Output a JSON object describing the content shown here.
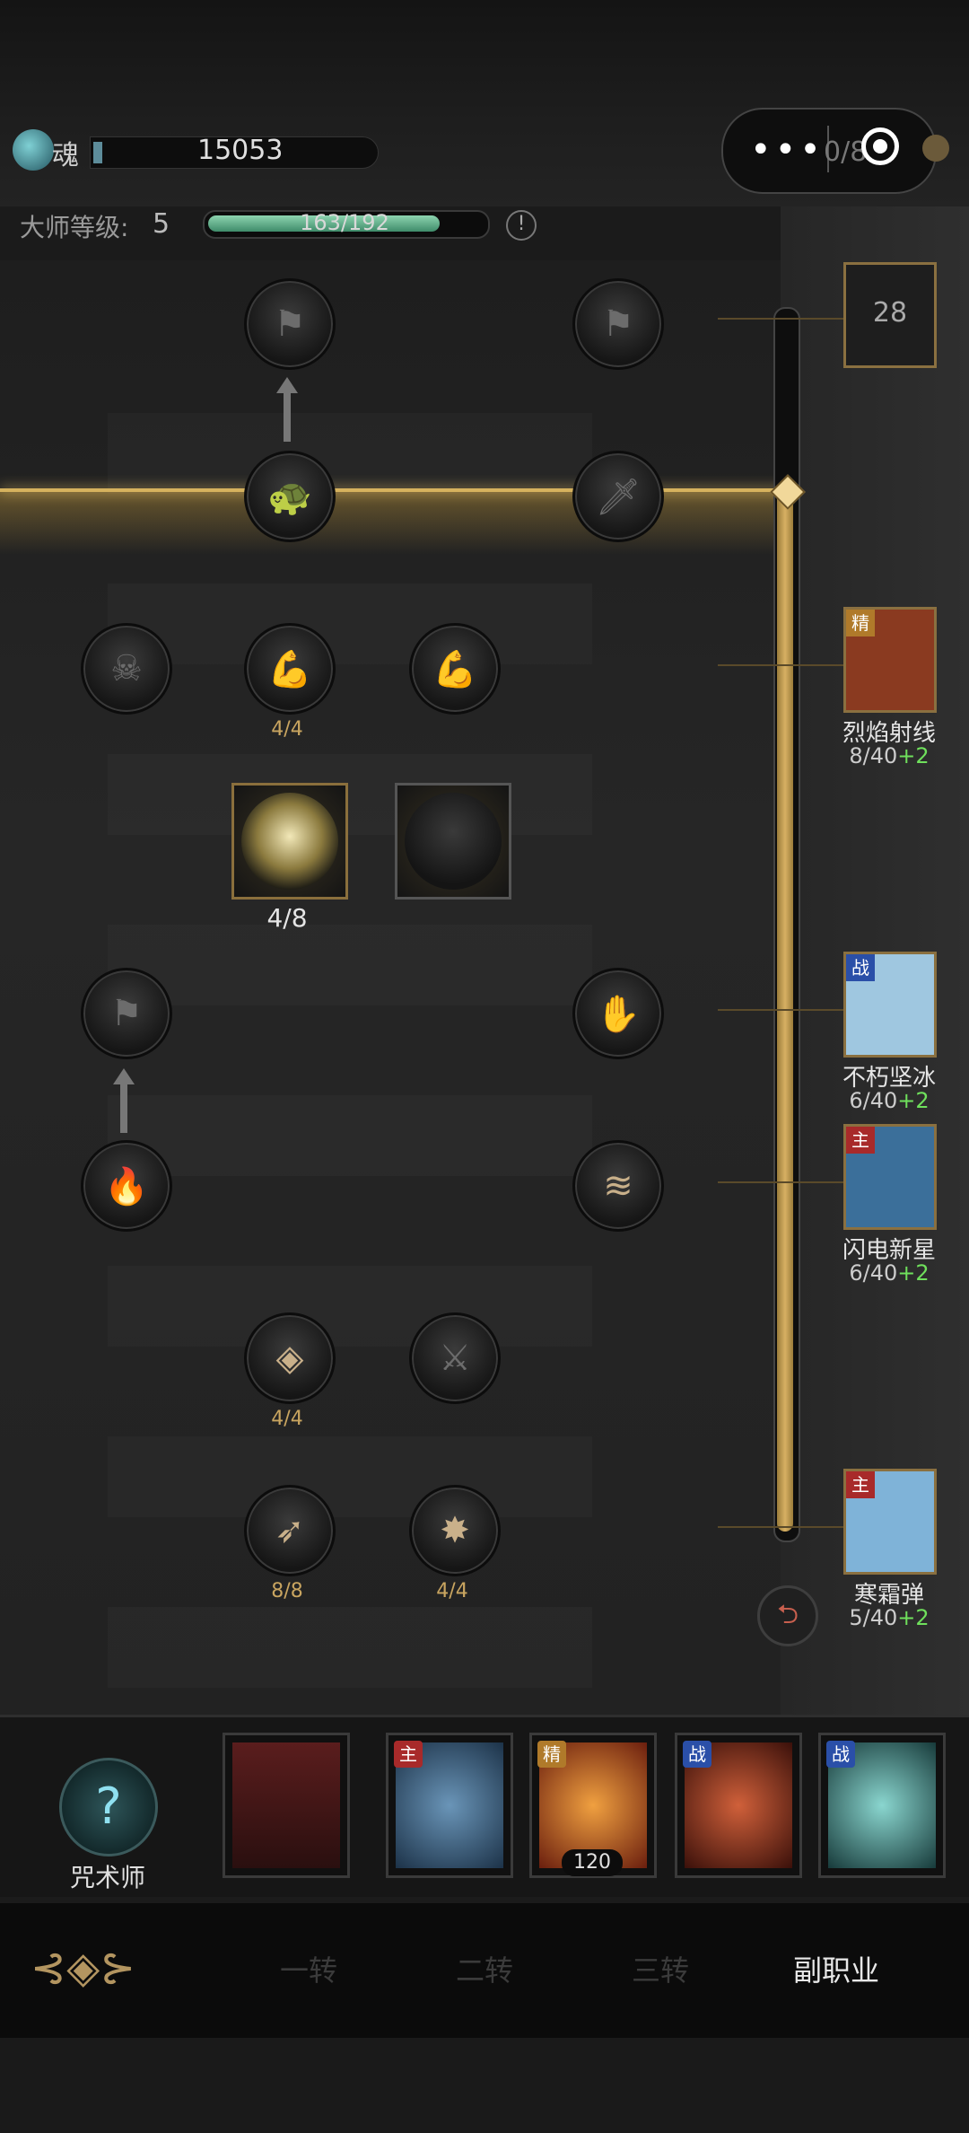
{
  "topbar": {
    "soul_label": "魂",
    "soul_value": "15053",
    "menu_dots": "•••",
    "capsule_text": "0/8"
  },
  "master": {
    "label": "大师等级:",
    "level": "5",
    "xp_text": "163/192",
    "xp_progress": 0.849,
    "info_glyph": "!"
  },
  "tree": {
    "counts": {
      "muscle_left": "4/4",
      "eclipse": "4/8",
      "gem": "4/4",
      "spear_left": "8/8",
      "spear_right": "4/4"
    }
  },
  "skills": [
    {
      "badge": "精",
      "name": "烈焰射线",
      "level": "8/40",
      "bonus": "+2",
      "badge_color": "#b07a2a",
      "art_color": "#8a3a20"
    },
    {
      "badge": "战",
      "name": "不朽坚冰",
      "level": "6/40",
      "bonus": "+2",
      "badge_color": "#2a4fa8",
      "art_color": "#9fc7e0"
    },
    {
      "badge": "主",
      "name": "闪电新星",
      "level": "6/40",
      "bonus": "+2",
      "badge_color": "#a82a2a",
      "art_color": "#3b6f9a"
    },
    {
      "badge": "主",
      "name": "寒霜弹",
      "level": "5/40",
      "bonus": "+2",
      "badge_color": "#a82a2a",
      "art_color": "#7fb3d8"
    }
  ],
  "rail": {
    "top_level": "28",
    "back_glyph": "⮌"
  },
  "bottom": {
    "job_name": "咒术师",
    "job_glyph": "?",
    "slots": [
      {
        "badge": "",
        "icon": "hammer-icon",
        "art_color": "#5a1d1d"
      },
      {
        "badge": "主",
        "icon": "wave-icon",
        "art_color": "#2c4f6e",
        "badge_color": "#a82a2a"
      },
      {
        "badge": "精",
        "icon": "fire-pillar-icon",
        "art_color": "#a83a18",
        "badge_color": "#b07a2a",
        "count": "120"
      },
      {
        "badge": "战",
        "icon": "flame-sword-icon",
        "art_color": "#7a2414",
        "badge_color": "#2a4fa8"
      },
      {
        "badge": "战",
        "icon": "shield-icon",
        "art_color": "#2f6b6a",
        "badge_color": "#2a4fa8"
      }
    ]
  },
  "tabs": {
    "items": [
      "一转",
      "二转",
      "三转",
      "副职业"
    ],
    "active": "副职业"
  }
}
